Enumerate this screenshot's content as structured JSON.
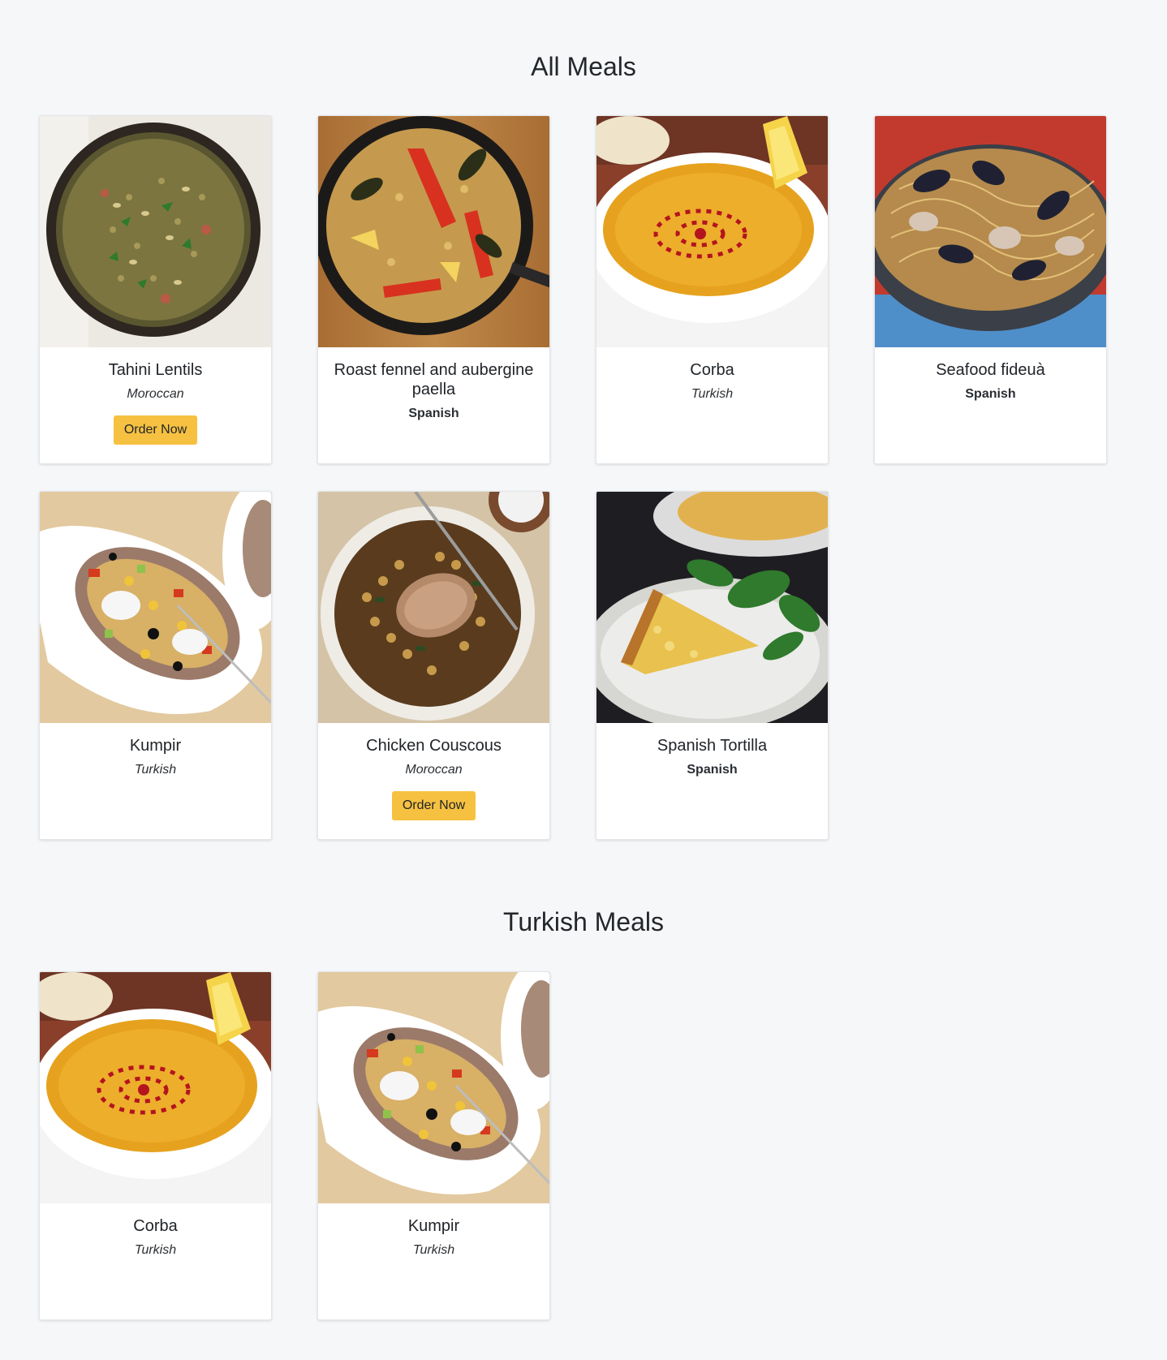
{
  "sections": [
    {
      "title": "All Meals",
      "meals": [
        {
          "name": "Tahini Lentils",
          "area": "Moroccan",
          "style": "italic",
          "order": true,
          "image": "lentils"
        },
        {
          "name": "Roast fennel and aubergine paella",
          "area": "Spanish",
          "style": "bold",
          "order": false,
          "image": "paella"
        },
        {
          "name": "Corba",
          "area": "Turkish",
          "style": "italic",
          "order": false,
          "image": "soup"
        },
        {
          "name": "Seafood fideuà",
          "area": "Spanish",
          "style": "bold",
          "order": false,
          "image": "seafood"
        },
        {
          "name": "Kumpir",
          "area": "Turkish",
          "style": "italic",
          "order": false,
          "image": "kumpir"
        },
        {
          "name": "Chicken Couscous",
          "area": "Moroccan",
          "style": "italic",
          "order": true,
          "image": "couscous"
        },
        {
          "name": "Spanish Tortilla",
          "area": "Spanish",
          "style": "bold",
          "order": false,
          "image": "tortilla"
        }
      ]
    },
    {
      "title": "Turkish Meals",
      "meals": [
        {
          "name": "Corba",
          "area": "Turkish",
          "style": "italic",
          "order": false,
          "image": "soup"
        },
        {
          "name": "Kumpir",
          "area": "Turkish",
          "style": "italic",
          "order": false,
          "image": "kumpir"
        }
      ]
    }
  ],
  "order_label": "Order Now",
  "colors": {
    "background": "#f6f7f9",
    "order_button": "#f6c141",
    "card": "#ffffff"
  }
}
